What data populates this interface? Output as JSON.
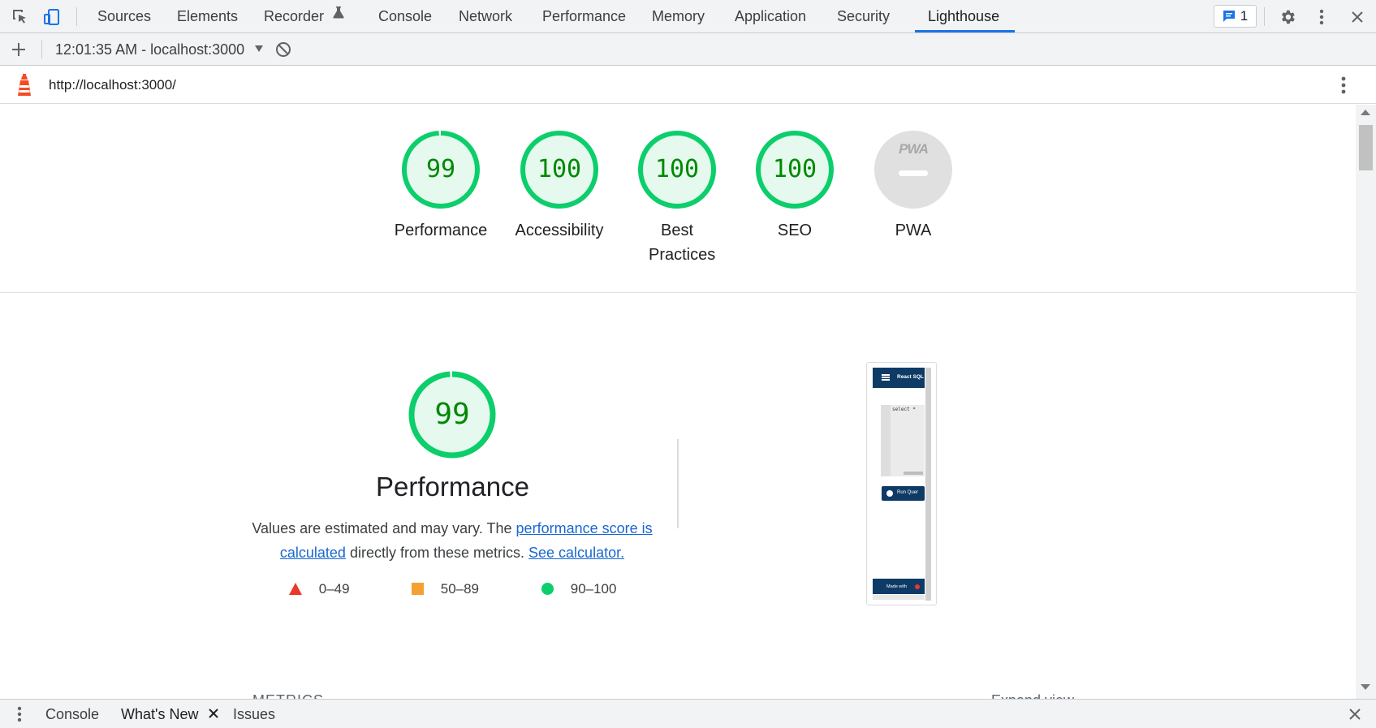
{
  "toolbar": {
    "tabs": [
      {
        "label": "Sources"
      },
      {
        "label": "Elements"
      },
      {
        "label": "Recorder"
      },
      {
        "label": "Console"
      },
      {
        "label": "Network"
      },
      {
        "label": "Performance"
      },
      {
        "label": "Memory"
      },
      {
        "label": "Application"
      },
      {
        "label": "Security"
      },
      {
        "label": "Lighthouse"
      }
    ],
    "active_tab": "Lighthouse",
    "issues_count": "1"
  },
  "subbar": {
    "run_label": "12:01:35 AM - localhost:3000"
  },
  "urlbar": {
    "url": "http://localhost:3000/"
  },
  "categories": [
    {
      "score": "99",
      "label": "Performance",
      "fraction": 0.99
    },
    {
      "score": "100",
      "label": "Accessibility",
      "fraction": 1.0
    },
    {
      "score": "100",
      "label": "Best Practices",
      "fraction": 1.0
    },
    {
      "score": "100",
      "label": "SEO",
      "fraction": 1.0
    },
    {
      "badge": "PWA",
      "label": "PWA"
    }
  ],
  "performance": {
    "score": "99",
    "fraction": 0.99,
    "title": "Performance",
    "desc_1": "Values are estimated and may vary. The ",
    "link_1": "performance score is calculated",
    "desc_2": " directly from these metrics. ",
    "link_2": "See calculator.",
    "legend": [
      {
        "range": "0–49",
        "color": "#e8392b",
        "shape": "triangle"
      },
      {
        "range": "50–89",
        "color": "#f5a132",
        "shape": "square"
      },
      {
        "range": "90–100",
        "color": "#0cce6b",
        "shape": "circle"
      }
    ]
  },
  "screenshot": {
    "app_title": "React SQL",
    "editor_text": "select *",
    "button_label": "Run Quer",
    "footer_text": "Made with"
  },
  "cut_off": {
    "metrics_heading": "METRICS",
    "expand_view": "Expand view"
  },
  "drawer": {
    "tabs": [
      {
        "label": "Console"
      },
      {
        "label": "What's New"
      },
      {
        "label": "Issues"
      }
    ]
  },
  "colors": {
    "pass": "#0cce6b",
    "pass_text": "#008800",
    "pass_fill": "#e5f9ee",
    "accent": "#1a73e8"
  }
}
